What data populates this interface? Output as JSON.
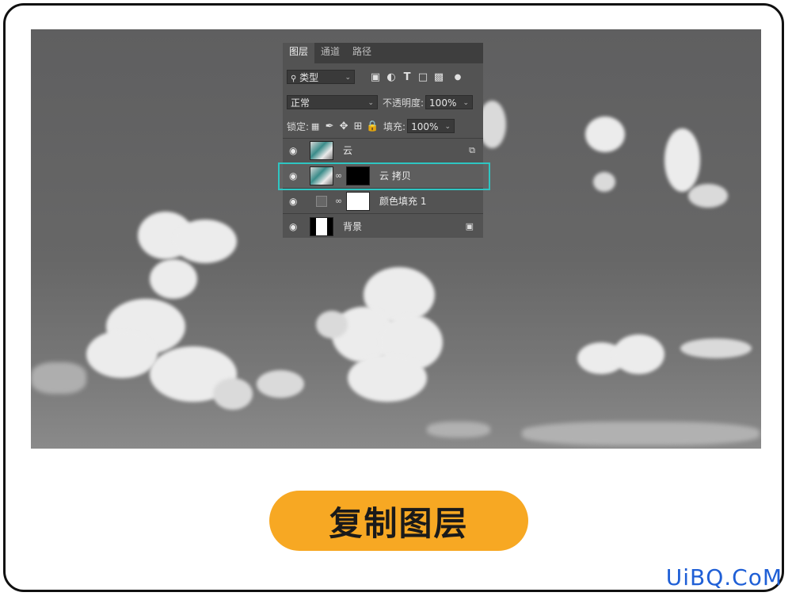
{
  "layers_panel": {
    "tabs": [
      "图层",
      "通道",
      "路径"
    ],
    "filter_kind": "类型",
    "blend_mode": "正常",
    "opacity_label": "不透明度:",
    "opacity_value": "100%",
    "lock_label": "锁定:",
    "fill_label": "填充:",
    "fill_value": "100%",
    "layers": [
      {
        "name": "云",
        "icon": "smart-object-icon"
      },
      {
        "name": "云 拷贝",
        "selected": true,
        "icon": "link-icon"
      },
      {
        "name": "颜色填充 1",
        "icon": "link-icon"
      },
      {
        "name": "背景",
        "icon": "lock-icon"
      }
    ]
  },
  "caption": "复制图层",
  "watermark": "UiBQ.CoM",
  "colors": {
    "highlight": "#2ec5c2",
    "caption_bg": "#f7a823",
    "watermark": "#1f5fd6"
  }
}
